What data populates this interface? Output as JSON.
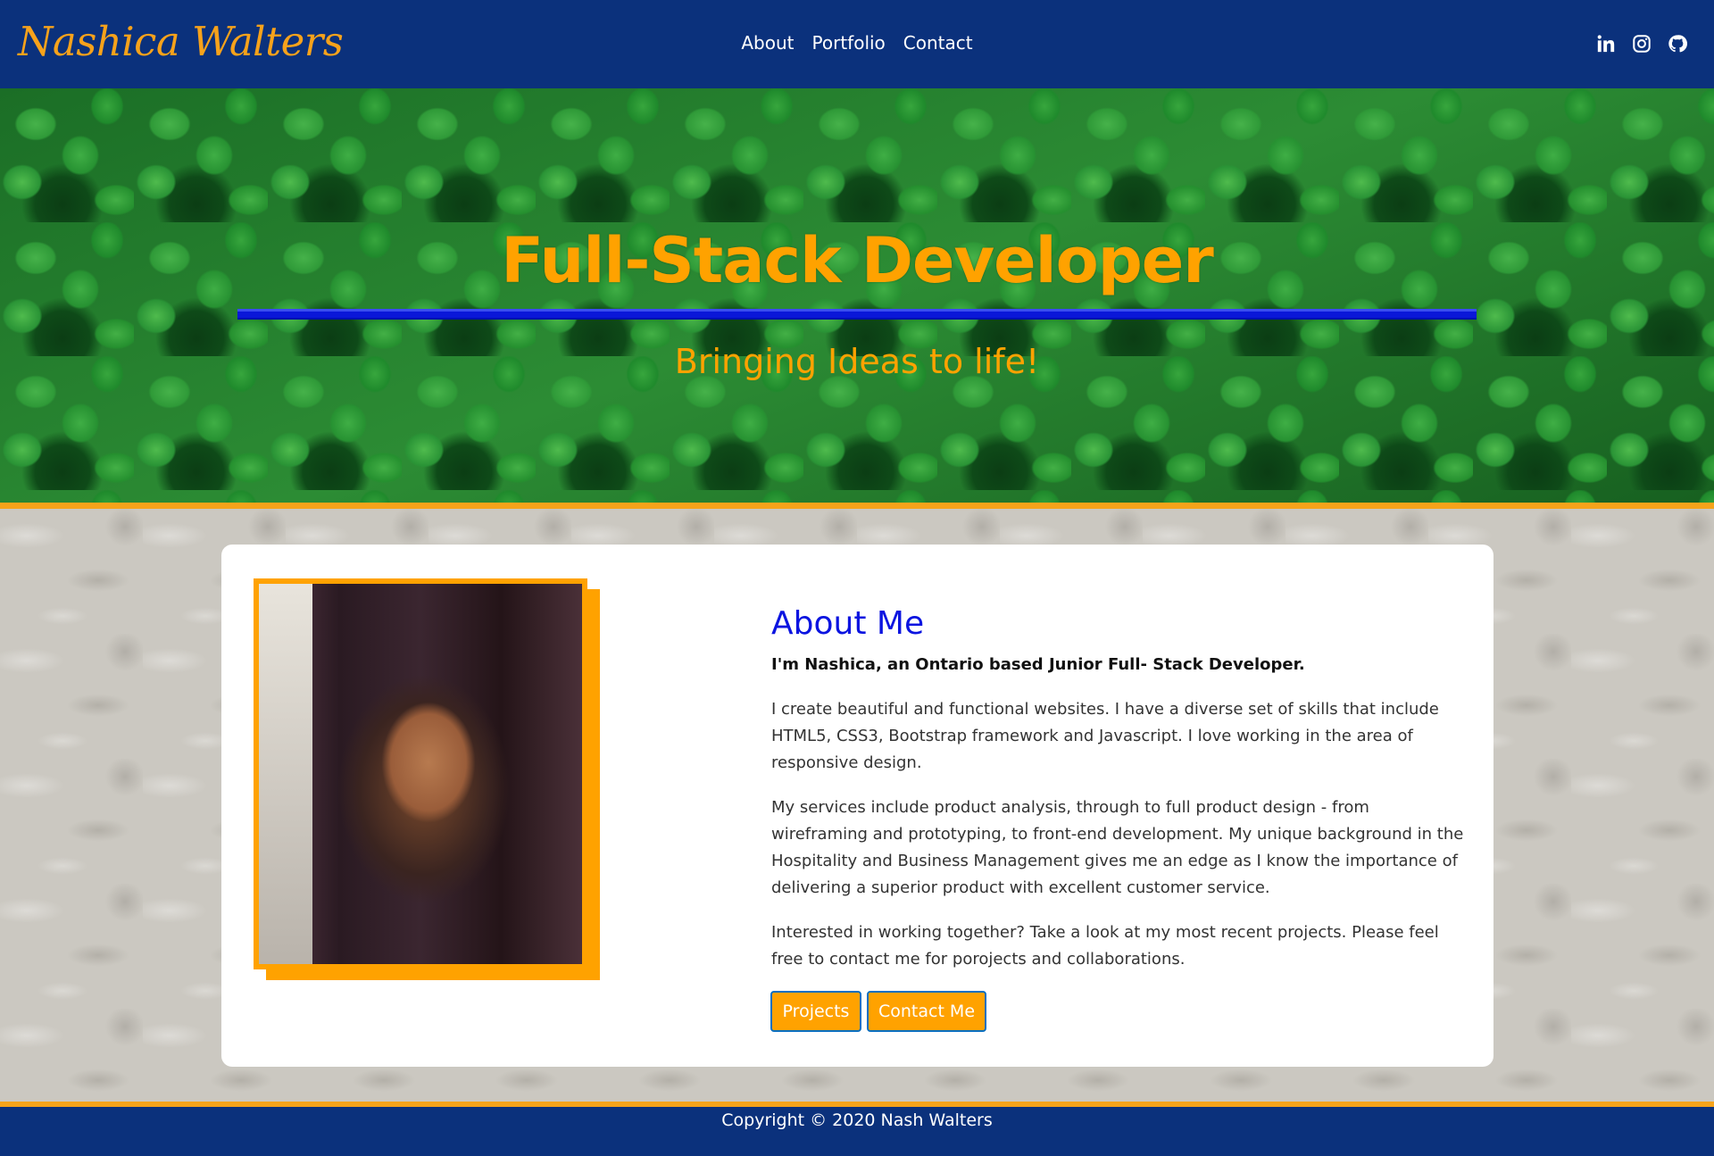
{
  "navbar": {
    "brand": "Nashica Walters",
    "links": [
      {
        "label": "About"
      },
      {
        "label": "Portfolio"
      },
      {
        "label": "Contact"
      }
    ],
    "social_icons": [
      "linkedin-icon",
      "instagram-icon",
      "github-icon"
    ]
  },
  "hero": {
    "title": "Full-Stack Developer",
    "subtitle": "Bringing Ideas to life!"
  },
  "about": {
    "title": "About Me",
    "lead": "I'm Nashica, an Ontario based Junior Full- Stack Developer.",
    "paragraphs": [
      "I create beautiful and functional websites. I have a diverse set of skills that include HTML5, CSS3, Bootstrap framework and Javascript. I love working in the area of responsive design.",
      "My services include product analysis, through to full product design - from wireframing and prototyping, to front-end development. My unique background in the Hospitality and Business Management gives me an edge as I know the importance of delivering a superior product with excellent customer service.",
      "Interested in working together? Take a look at my most recent projects. Please feel free to contact me for porojects and collaborations."
    ],
    "buttons": {
      "projects": "Projects",
      "contact": "Contact Me"
    }
  },
  "footer": {
    "copyright": "Copyright © 2020 Nash Walters"
  },
  "colors": {
    "navy": "#0b317c",
    "orange": "#ffa200",
    "blue_heading": "#0b14e0"
  }
}
